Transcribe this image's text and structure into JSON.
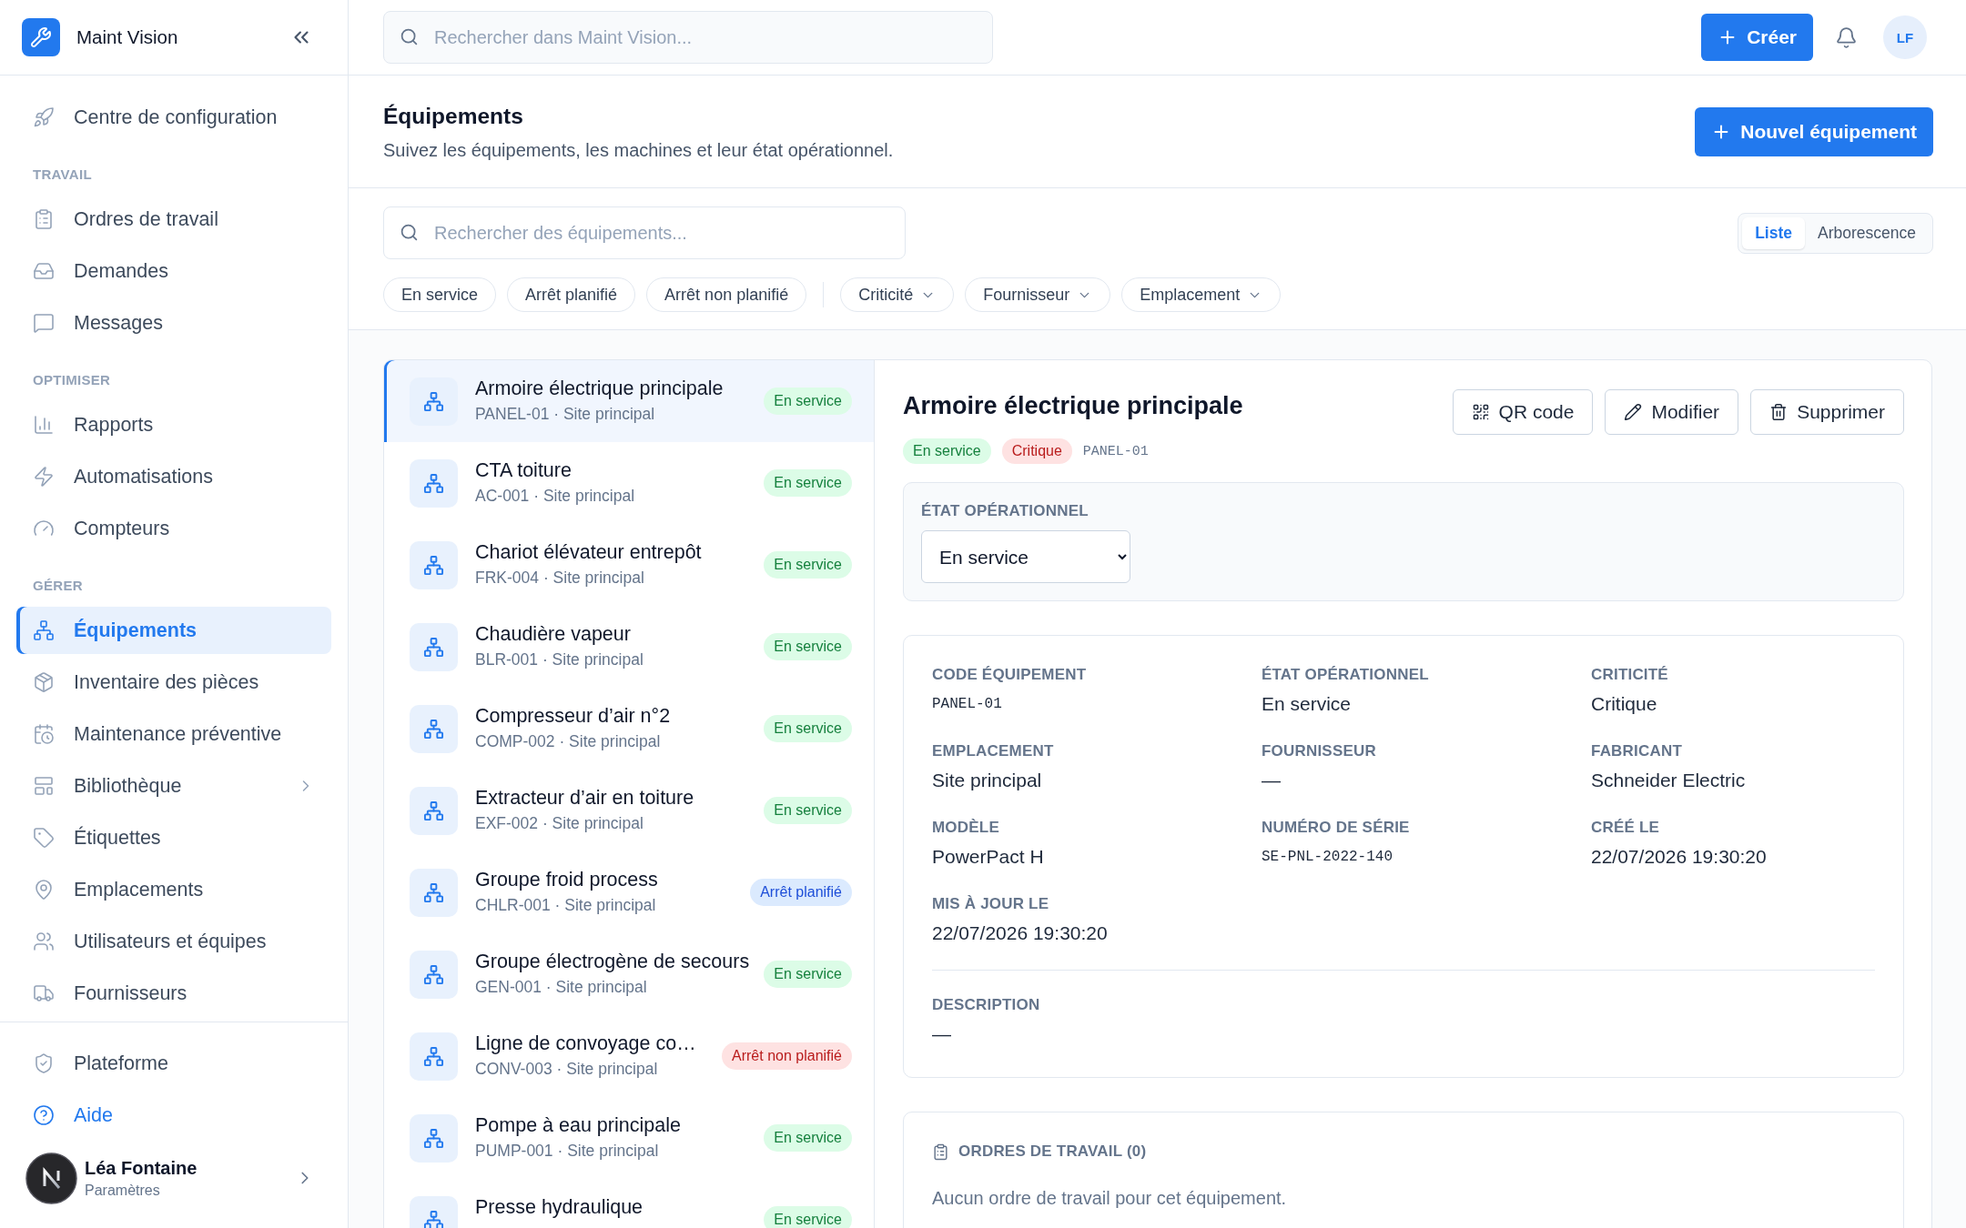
{
  "app": {
    "name": "Maint Vision"
  },
  "sidebar": {
    "top_items": [
      {
        "label": "Centre de configuration",
        "selected": false
      }
    ],
    "sections": [
      {
        "title": "TRAVAIL",
        "items": [
          {
            "label": "Ordres de travail",
            "selected": false,
            "expandable": false
          },
          {
            "label": "Demandes",
            "selected": false,
            "expandable": false
          },
          {
            "label": "Messages",
            "selected": false,
            "expandable": false
          }
        ]
      },
      {
        "title": "OPTIMISER",
        "items": [
          {
            "label": "Rapports",
            "selected": false,
            "expandable": false
          },
          {
            "label": "Automatisations",
            "selected": false,
            "expandable": false
          },
          {
            "label": "Compteurs",
            "selected": false,
            "expandable": false
          }
        ]
      },
      {
        "title": "GÉRER",
        "items": [
          {
            "label": "Équipements",
            "selected": true,
            "expandable": false
          },
          {
            "label": "Inventaire des pièces",
            "selected": false,
            "expandable": false
          },
          {
            "label": "Maintenance préventive",
            "selected": false,
            "expandable": false
          },
          {
            "label": "Bibliothèque",
            "selected": false,
            "expandable": true
          },
          {
            "label": "Étiquettes",
            "selected": false,
            "expandable": false
          },
          {
            "label": "Emplacements",
            "selected": false,
            "expandable": false
          },
          {
            "label": "Utilisateurs et équipes",
            "selected": false,
            "expandable": false
          },
          {
            "label": "Fournisseurs",
            "selected": false,
            "expandable": false
          }
        ]
      }
    ],
    "footer_items": [
      {
        "label": "Plateforme",
        "highlighted": false
      },
      {
        "label": "Aide",
        "highlighted": true
      }
    ],
    "user": {
      "name": "Léa Fontaine",
      "subtitle": "Paramètres"
    }
  },
  "topbar": {
    "search": {
      "placeholder": "Rechercher dans Maint Vision..."
    },
    "create_button": "Créer",
    "avatar_initials": "LF"
  },
  "page_header": {
    "title": "Équipements",
    "subtitle": "Suivez les équipements, les machines et leur état opérationnel.",
    "primary_button": "Nouvel équipement"
  },
  "filters": {
    "search": {
      "placeholder": "Rechercher des équipements..."
    },
    "view_tabs": [
      {
        "label": "Liste",
        "selected": true
      },
      {
        "label": "Arborescence",
        "selected": false
      }
    ],
    "status_chips": [
      {
        "label": "En service",
        "selected": false
      },
      {
        "label": "Arrêt planifié",
        "selected": false
      },
      {
        "label": "Arrêt non planifié",
        "selected": false
      }
    ],
    "dropdowns": [
      {
        "label": "Criticité"
      },
      {
        "label": "Fournisseur"
      },
      {
        "label": "Emplacement"
      }
    ]
  },
  "equipment_list": {
    "items": [
      {
        "name": "Armoire électrique principale",
        "subtitle": "PANEL-01 · Site principal",
        "status": {
          "label": "En service",
          "kind": "in_service"
        },
        "selected": true
      },
      {
        "name": "CTA toiture",
        "subtitle": "AC-001 · Site principal",
        "status": {
          "label": "En service",
          "kind": "in_service"
        },
        "selected": false
      },
      {
        "name": "Chariot élévateur entrepôt",
        "subtitle": "FRK-004 · Site principal",
        "status": {
          "label": "En service",
          "kind": "in_service"
        },
        "selected": false
      },
      {
        "name": "Chaudière vapeur",
        "subtitle": "BLR-001 · Site principal",
        "status": {
          "label": "En service",
          "kind": "in_service"
        },
        "selected": false
      },
      {
        "name": "Compresseur d’air n°2",
        "subtitle": "COMP-002 · Site principal",
        "status": {
          "label": "En service",
          "kind": "in_service"
        },
        "selected": false
      },
      {
        "name": "Extracteur d’air en toiture",
        "subtitle": "EXF-002 · Site principal",
        "status": {
          "label": "En service",
          "kind": "in_service"
        },
        "selected": false
      },
      {
        "name": "Groupe froid process",
        "subtitle": "CHLR-001 · Site principal",
        "status": {
          "label": "Arrêt planifié",
          "kind": "planned"
        },
        "selected": false
      },
      {
        "name": "Groupe électrogène de secours",
        "subtitle": "GEN-001 · Site principal",
        "status": {
          "label": "En service",
          "kind": "in_service"
        },
        "selected": false
      },
      {
        "name": "Ligne de convoyage co…",
        "subtitle": "CONV-003 · Site principal",
        "status": {
          "label": "Arrêt non planifié",
          "kind": "unplanned"
        },
        "selected": false
      },
      {
        "name": "Pompe à eau principale",
        "subtitle": "PUMP-001 · Site principal",
        "status": {
          "label": "En service",
          "kind": "in_service"
        },
        "selected": false
      },
      {
        "name": "Presse hydraulique",
        "status": {
          "label": "En service",
          "kind": "in_service"
        },
        "selected": false
      }
    ]
  },
  "detail": {
    "title": "Armoire électrique principale",
    "badges": [
      {
        "label": "En service",
        "kind": "in_service"
      },
      {
        "label": "Critique",
        "kind": "critical"
      }
    ],
    "code": "PANEL-01",
    "actions": [
      "QR code",
      "Modifier",
      "Supprimer"
    ],
    "state_card": {
      "label": "ÉTAT OPÉRATIONNEL",
      "select_value": "En service"
    },
    "fields": [
      {
        "label": "CODE ÉQUIPEMENT",
        "value": "PANEL-01",
        "kind": "code"
      },
      {
        "label": "ÉTAT OPÉRATIONNEL",
        "value": "En service",
        "kind": "text"
      },
      {
        "label": "CRITICITÉ",
        "value": "Critique",
        "kind": "text"
      },
      {
        "label": "EMPLACEMENT",
        "value": "Site principal",
        "kind": "text"
      },
      {
        "label": "FOURNISSEUR",
        "value": "—",
        "kind": "text"
      },
      {
        "label": "FABRICANT",
        "value": "Schneider Electric",
        "kind": "text"
      },
      {
        "label": "MODÈLE",
        "value": "PowerPact H",
        "kind": "text"
      },
      {
        "label": "NUMÉRO DE SÉRIE",
        "value": "SE-PNL-2022-140",
        "kind": "code"
      },
      {
        "label": "CRÉÉ LE",
        "value": "22/07/2026 19:30:20",
        "kind": "text"
      },
      {
        "label": "MIS À JOUR LE",
        "value": "22/07/2026 19:30:20",
        "kind": "text"
      }
    ],
    "description": {
      "label": "DESCRIPTION",
      "value": "—"
    },
    "work_orders": {
      "title": "ORDRES DE TRAVAIL (0)",
      "empty_text": "Aucun ordre de travail pour cet équipement."
    }
  }
}
